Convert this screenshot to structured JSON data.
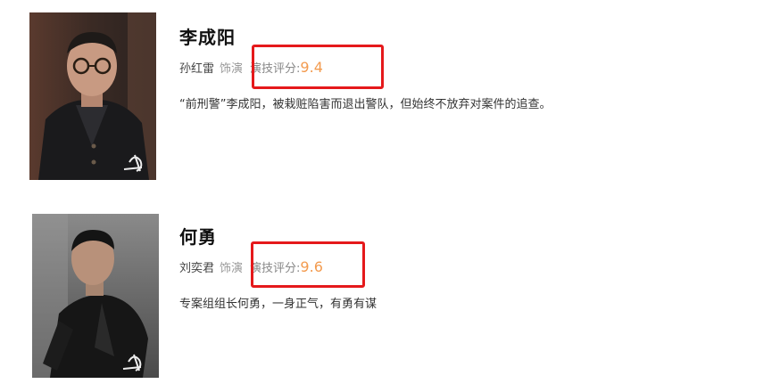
{
  "characters": [
    {
      "name": "李成阳",
      "actor": "孙红雷",
      "role_word": "饰演",
      "score_label": "演技评分:",
      "score": "9.4",
      "description": "“前刑警”李成阳，被栽赃陷害而退出警队，但始终不放弃对案件的追查。",
      "photo_icon": "actor-portrait-icon"
    },
    {
      "name": "何勇",
      "actor": "刘奕君",
      "role_word": "饰演",
      "score_label": "演技评分:",
      "score": "9.6",
      "description": "专案组组长何勇，一身正气，有勇有谋",
      "photo_icon": "actor-portrait-icon"
    }
  ],
  "colors": {
    "score": "#f39b4f",
    "highlight_border": "#e5191b"
  }
}
